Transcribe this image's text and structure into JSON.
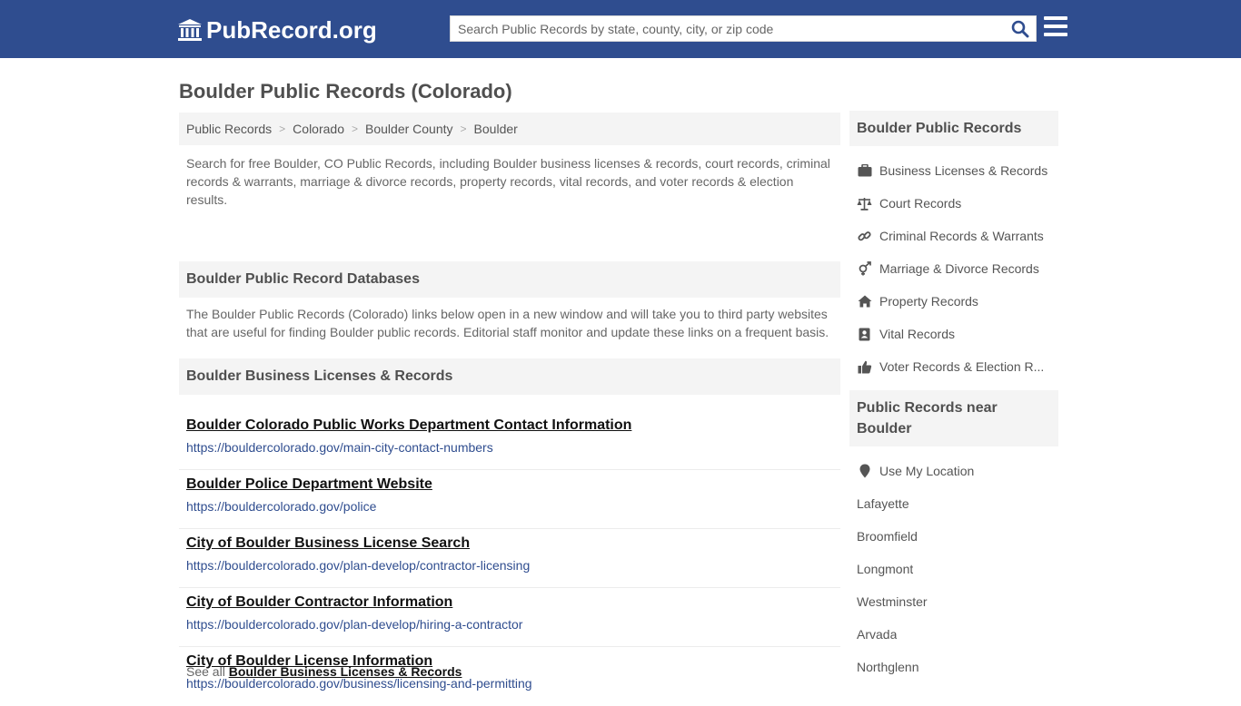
{
  "header": {
    "logo_text": "PubRecord.org",
    "search_placeholder": "Search Public Records by state, county, city, or zip code"
  },
  "page_title": "Boulder Public Records (Colorado)",
  "breadcrumb": [
    "Public Records",
    "Colorado",
    "Boulder County",
    "Boulder"
  ],
  "intro": "Search for free Boulder, CO Public Records, including Boulder business licenses & records, court records, criminal records & warrants, marriage & divorce records, property records, vital records, and voter records & election results.",
  "databases": {
    "heading": "Boulder Public Record Databases",
    "text": "The Boulder Public Records (Colorado) links below open in a new window and will take you to third party websites that are useful for finding Boulder public records. Editorial staff monitor and update these links on a frequent basis."
  },
  "business": {
    "heading": "Boulder Business Licenses & Records",
    "links": [
      {
        "title": "Boulder Colorado Public Works Department Contact Information",
        "url": "https://bouldercolorado.gov/main-city-contact-numbers"
      },
      {
        "title": "Boulder Police Department Website",
        "url": "https://bouldercolorado.gov/police"
      },
      {
        "title": "City of Boulder Business License Search",
        "url": "https://bouldercolorado.gov/plan-develop/contractor-licensing"
      },
      {
        "title": "City of Boulder Contractor Information",
        "url": "https://bouldercolorado.gov/plan-develop/hiring-a-contractor"
      },
      {
        "title": "City of Boulder License Information",
        "url": "https://bouldercolorado.gov/business/licensing-and-permitting"
      }
    ],
    "see_all_prefix": "See all",
    "see_all_link": "Boulder Business Licenses & Records"
  },
  "sidebar": {
    "records_heading": "Boulder Public Records",
    "records": [
      {
        "label": "Business Licenses & Records",
        "icon": "briefcase-icon"
      },
      {
        "label": "Court Records",
        "icon": "scale-icon"
      },
      {
        "label": "Criminal Records & Warrants",
        "icon": "link-icon"
      },
      {
        "label": "Marriage & Divorce Records",
        "icon": "gender-icon"
      },
      {
        "label": "Property Records",
        "icon": "home-icon"
      },
      {
        "label": "Vital Records",
        "icon": "id-book-icon"
      },
      {
        "label": "Voter Records & Election R...",
        "icon": "thumbs-up-icon"
      }
    ],
    "nearby_heading": "Public Records near Boulder",
    "use_location": "Use My Location",
    "nearby": [
      "Lafayette",
      "Broomfield",
      "Longmont",
      "Westminster",
      "Arvada",
      "Northglenn"
    ]
  },
  "colors": {
    "header_bg": "#2f4d8f",
    "url_blue": "#2f4d8f"
  }
}
